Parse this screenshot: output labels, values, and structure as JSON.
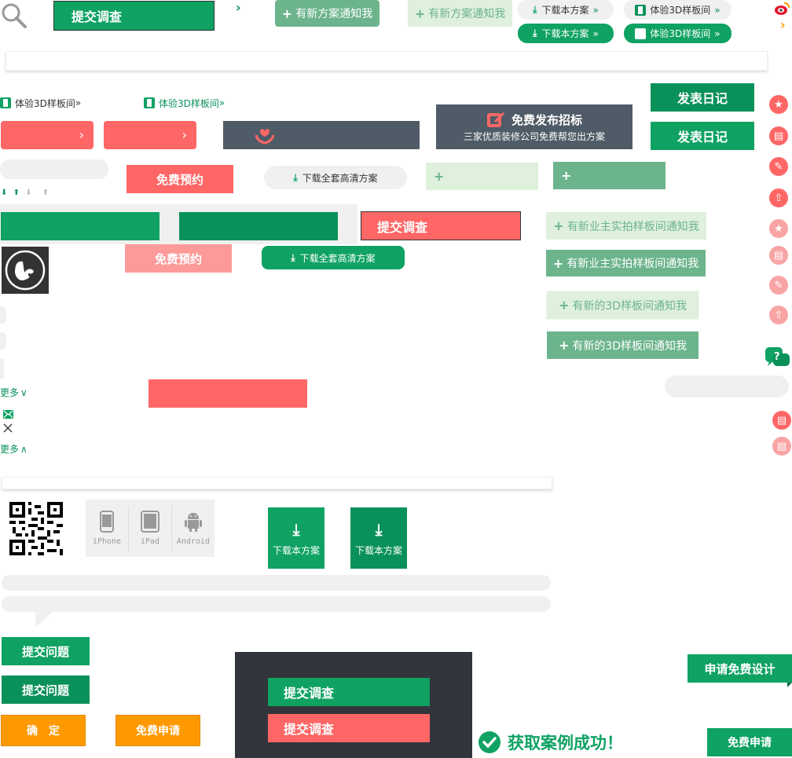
{
  "top": {
    "survey_btn": "提交调查",
    "notify_plan": "有新方案通知我",
    "download_plan": "下载本方案",
    "experience_3d": "体验3D样板间",
    "chevron": "›",
    "double_chevron": "»"
  },
  "row2": {
    "experience_3d": "体验3D样板间",
    "free_bid_title": "免费发布招标",
    "free_bid_sub": "三家优质装修公司免费帮您出方案",
    "diary_btn": "发表日记"
  },
  "row3": {
    "free_booking": "免费预约",
    "download_all_hd": "下载全套高清方案",
    "arrows": [
      "⬇",
      "⬆",
      "⬇",
      "⬆"
    ]
  },
  "mid": {
    "survey_btn": "提交调查",
    "free_booking": "免费预约",
    "download_all_hd": "下载全套高清方案",
    "owner_notify": "有新业主实拍样板间通知我",
    "new_3d_notify": "有新的3D样板间通知我",
    "more": "更多",
    "more_down": "∨",
    "more_up": "∧"
  },
  "apps": {
    "items": [
      "iPhone",
      "iPad",
      "Android"
    ],
    "download_plan": "下载本方案"
  },
  "bottom": {
    "submit_question": "提交问题",
    "confirm": "确　定",
    "free_apply": "免费申请",
    "survey_btn": "提交调查",
    "success": "获取案例成功！",
    "apply_design": "申请免费设计"
  },
  "colors": {
    "green": "#0fa263",
    "dark_green": "#0a915a",
    "red": "#ff6666",
    "slate": "#4f5b66",
    "orange": "#ff9900",
    "dark_panel": "#32353b"
  },
  "icons": [
    "search-icon",
    "weibo-icon",
    "download-icon",
    "cube-3d-icon",
    "edit-icon",
    "heart-hand-icon",
    "star-icon",
    "chat-icon",
    "pen-icon",
    "upload-icon",
    "qq-icon",
    "qr-code",
    "phone-icon",
    "tablet-icon",
    "android-icon",
    "check-circle-icon",
    "mail-icon",
    "close-icon"
  ]
}
